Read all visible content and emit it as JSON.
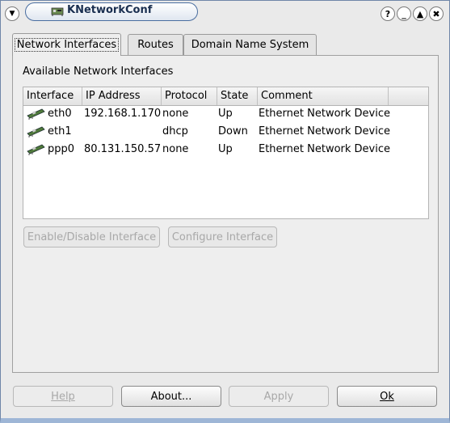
{
  "window": {
    "title": "KNetworkConf",
    "controls": [
      "?",
      "_",
      "▲",
      "✖"
    ]
  },
  "tabs": [
    {
      "label": "Network Interfaces",
      "active": true
    },
    {
      "label": "Routes",
      "active": false
    },
    {
      "label": "Domain Name System",
      "active": false
    }
  ],
  "section": {
    "title": "Available Network Interfaces"
  },
  "table": {
    "columns": [
      "Interface",
      "IP Address",
      "Protocol",
      "State",
      "Comment"
    ],
    "rows": [
      {
        "interface": "eth0",
        "ip": "192.168.1.170",
        "protocol": "none",
        "state": "Up",
        "comment": "Ethernet Network Device"
      },
      {
        "interface": "eth1",
        "ip": "",
        "protocol": "dhcp",
        "state": "Down",
        "comment": "Ethernet Network Device"
      },
      {
        "interface": "ppp0",
        "ip": "80.131.150.57",
        "protocol": "none",
        "state": "Up",
        "comment": "Ethernet Network Device"
      }
    ]
  },
  "panel_buttons": {
    "enable_disable": "Enable/Disable Interface",
    "configure": "Configure Interface"
  },
  "bottom_buttons": {
    "help": "Help",
    "about": "About...",
    "apply": "Apply",
    "ok": "Ok"
  },
  "colors": {
    "accent": "#4a6ea0",
    "window_bg": "#eaeaea",
    "disabled_text": "#a8a8a8"
  }
}
